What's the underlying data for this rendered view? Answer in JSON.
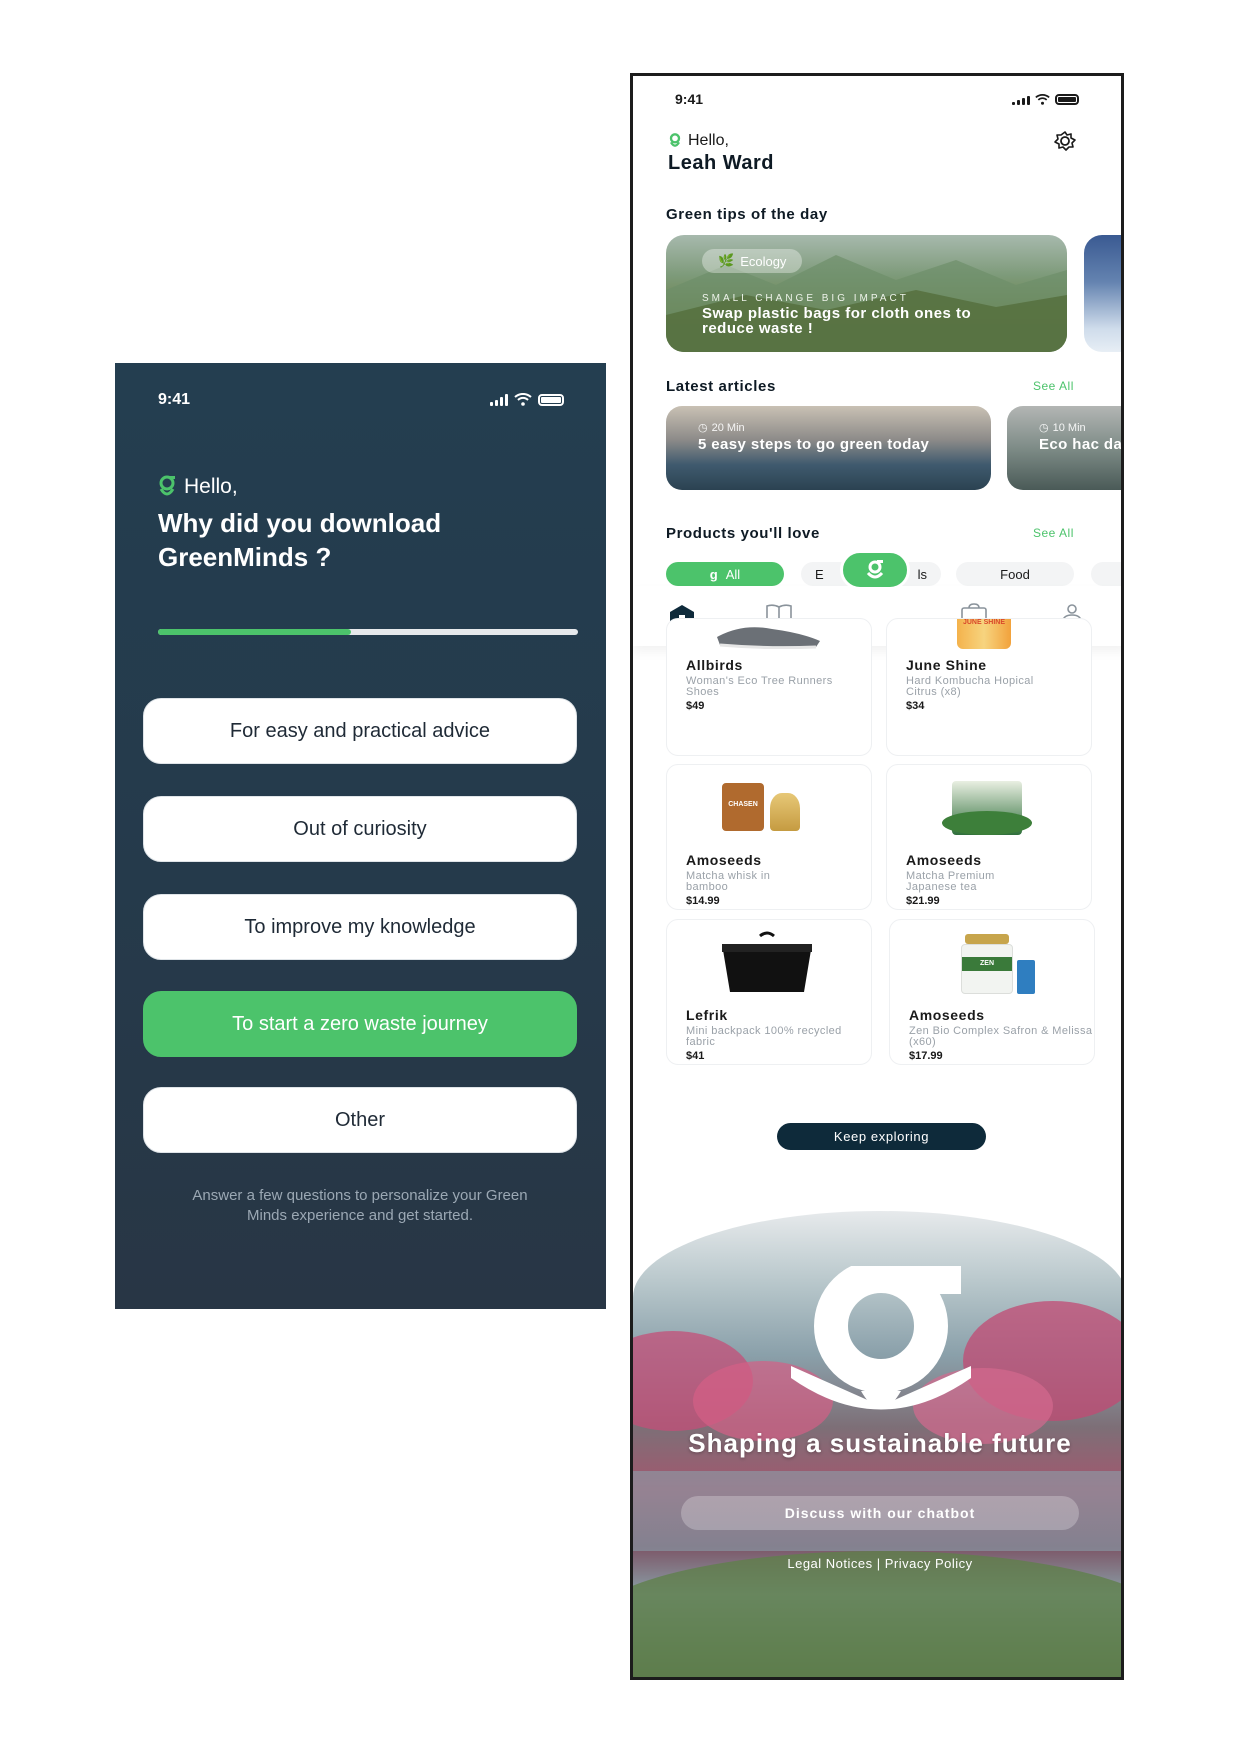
{
  "onboarding": {
    "status": {
      "time": "9:41"
    },
    "hello": "Hello,",
    "question": "Why did you download GreenMinds ?",
    "progress_percent": 46,
    "options": [
      {
        "label": "For easy and practical advice",
        "selected": false
      },
      {
        "label": "Out of curiosity",
        "selected": false
      },
      {
        "label": "To improve my knowledge",
        "selected": false
      },
      {
        "label": "To start a zero waste journey",
        "selected": true
      },
      {
        "label": "Other",
        "selected": false
      }
    ],
    "footer": "Answer a few questions to personalize your Green Minds experience and get started."
  },
  "home": {
    "status": {
      "time": "9:41"
    },
    "hello": "Hello,",
    "user_name": "Leah Ward",
    "tips": {
      "title": "Green tips of the day",
      "card": {
        "tag": "Ecology",
        "kicker": "SMALL CHANGE BIG IMPACT",
        "text": "Swap plastic bags for cloth ones to reduce waste !"
      }
    },
    "articles": {
      "title": "Latest articles",
      "see_all": "See All",
      "items": [
        {
          "duration": "20 Min",
          "title": "5 easy steps to go green today"
        },
        {
          "duration": "10 Min",
          "title": "Eco hac daily lif"
        }
      ]
    },
    "products": {
      "title": "Products you'll love",
      "see_all": "See All",
      "chips": [
        {
          "label": "All",
          "active": true
        },
        {
          "label": "E",
          "active": false
        },
        {
          "label": "ls",
          "active": false
        },
        {
          "label": "Food",
          "active": false
        }
      ],
      "items": [
        {
          "brand": "Allbirds",
          "desc": "Woman's Eco Tree Runners Shoes",
          "price": "$49"
        },
        {
          "brand": "June Shine",
          "desc": "Hard Kombucha Hopical Citrus (x8)",
          "price": "$34"
        },
        {
          "brand": "Amoseeds",
          "desc": "Matcha whisk in bamboo",
          "price": "$14.99"
        },
        {
          "brand": "Amoseeds",
          "desc": "Matcha Premium Japanese tea",
          "price": "$21.99"
        },
        {
          "brand": "Lefrik",
          "desc": "Mini backpack 100% recycled fabric",
          "price": "$41"
        },
        {
          "brand": "Amoseeds",
          "desc": "Zen Bio Complex Safron & Melissa (x60)",
          "price": "$17.99"
        }
      ],
      "product_label_1": "JUNE SHINE",
      "product_label_2": "CHASEN",
      "product_label_3": "ZEN"
    },
    "keep_exploring": "Keep exploring",
    "hero": {
      "title": "Shaping a sustainable future",
      "button": "Discuss with our chatbot",
      "links": "Legal Notices | Privacy Policy"
    },
    "nav": [
      "home-icon",
      "book-icon",
      "logo-icon",
      "bag-icon",
      "profile-icon"
    ],
    "colors": {
      "accent": "#4cc36b",
      "dark": "#0e2a3a",
      "onboarding_bg": "#253a4b"
    }
  }
}
